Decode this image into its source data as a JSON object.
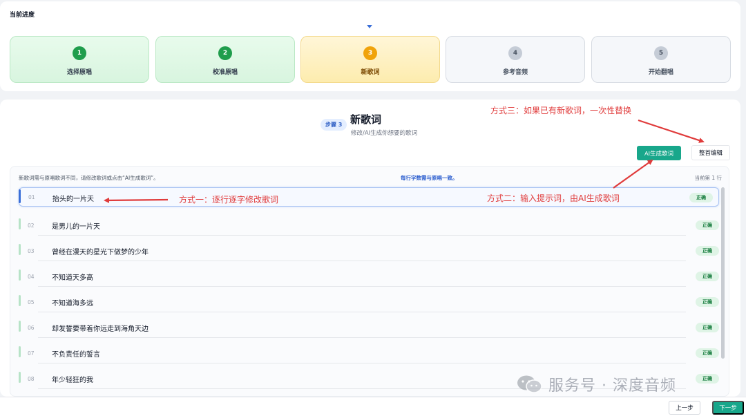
{
  "progress": {
    "title": "当前进度",
    "steps": [
      {
        "num": "1",
        "label": "选择原唱",
        "state": "done"
      },
      {
        "num": "2",
        "label": "校准原唱",
        "state": "done"
      },
      {
        "num": "3",
        "label": "新歌词",
        "state": "active"
      },
      {
        "num": "4",
        "label": "参考音频",
        "state": "todo"
      },
      {
        "num": "5",
        "label": "开始翻唱",
        "state": "todo"
      }
    ]
  },
  "main": {
    "step_badge": "步骤 3",
    "title": "新歌词",
    "subtitle": "修改/AI生成你想要的歌词",
    "ai_button": "AI生成歌词",
    "whole_edit_button": "整首编辑",
    "hint": "新歌词需与原唱歌词不同，请修改歌词或点击“AI生成歌词”。",
    "rule": "每行字数需与原唱一致。",
    "current_line": "当前第 1 行"
  },
  "lyrics": [
    {
      "num": "01",
      "text": "抬头的一片天",
      "status": "正确"
    },
    {
      "num": "02",
      "text": "是男儿的一片天",
      "status": "正确"
    },
    {
      "num": "03",
      "text": "曾经在漫天的星光下做梦的少年",
      "status": "正确"
    },
    {
      "num": "04",
      "text": "不知道天多高",
      "status": "正确"
    },
    {
      "num": "05",
      "text": "不知道海多远",
      "status": "正确"
    },
    {
      "num": "06",
      "text": "却发誓要带着你远走到海角天边",
      "status": "正确"
    },
    {
      "num": "07",
      "text": "不负责任的誓言",
      "status": "正确"
    },
    {
      "num": "08",
      "text": "年少轻狂的我",
      "status": "正确"
    }
  ],
  "annotations": {
    "method1": "方式一：逐行逐字修改歌词",
    "method2": "方式二：输入提示词，由AI生成歌词",
    "method3": "方式三：如果已有新歌词，一次性替换"
  },
  "footer": {
    "prev": "上一步",
    "next": "下一步"
  },
  "watermark": "服务号 · 深度音频",
  "colors": {
    "accent": "#18a78b",
    "done": "#1f9d4c",
    "active": "#f0a30a",
    "annotation": "#e03b3b",
    "link_blue": "#2d5fcf"
  }
}
